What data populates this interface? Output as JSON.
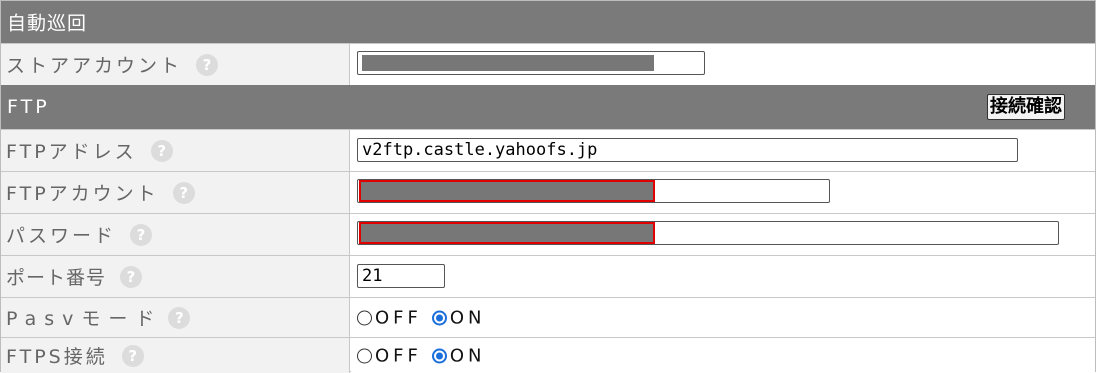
{
  "sections": {
    "auto": {
      "title": "自動巡回"
    },
    "ftp": {
      "title": "FTP",
      "check_button": "接続確認"
    }
  },
  "help_glyph": "?",
  "rows": {
    "store_account": {
      "label": "ストアアカウント",
      "value": ""
    },
    "ftp_address": {
      "label": "FTPアドレス",
      "value": "v2ftp.castle.yahoofs.jp"
    },
    "ftp_account": {
      "label": "FTPアカウント",
      "value": ""
    },
    "password": {
      "label": "パスワード",
      "value": ""
    },
    "port": {
      "label": "ポート番号",
      "value": "21"
    },
    "pasv_mode": {
      "label": "Pasvモード",
      "options": [
        "OFF",
        "ON"
      ],
      "selected": "ON"
    },
    "ftps": {
      "label": "FTPS接続",
      "options": [
        "OFF",
        "ON"
      ],
      "selected": "ON"
    }
  },
  "colors": {
    "header_bg": "#7a7a7a",
    "label_bg": "#f2f2f2",
    "radio_accent": "#1a6fdb",
    "highlight": "#e00000"
  }
}
